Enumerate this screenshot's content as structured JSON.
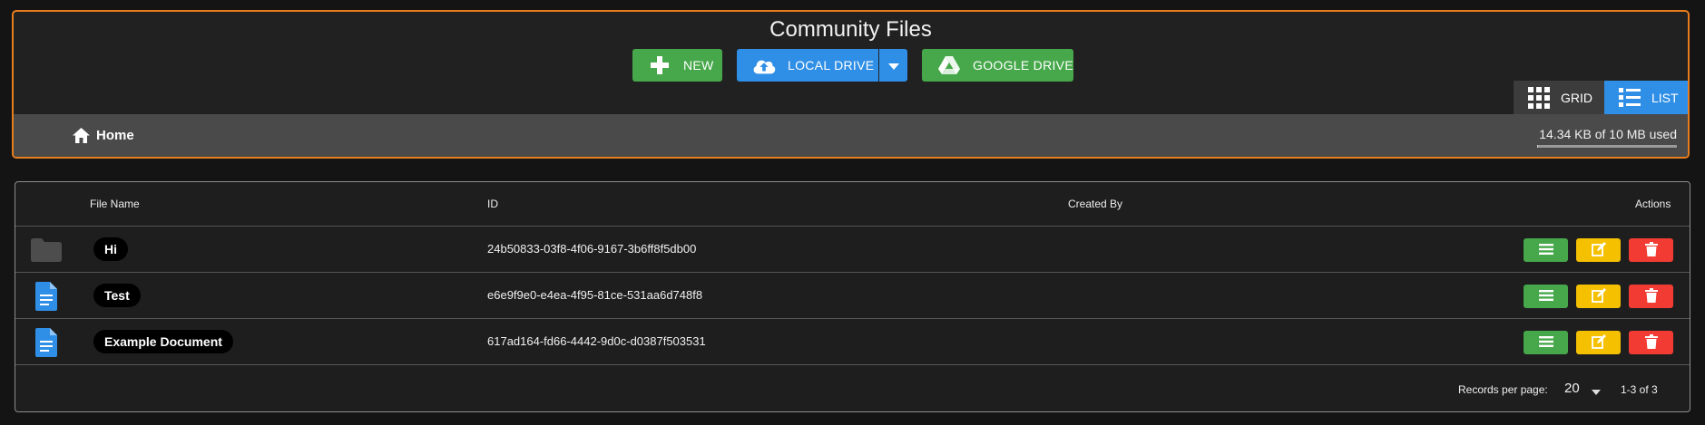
{
  "header": {
    "title": "Community Files",
    "buttons": {
      "new_label": "NEW",
      "local_drive_label": "LOCAL DRIVE",
      "google_drive_label": "GOOGLE DRIVE"
    },
    "view_toggle": {
      "grid_label": "GRID",
      "list_label": "LIST",
      "active": "LIST"
    },
    "breadcrumb": {
      "home_label": "Home"
    },
    "storage": {
      "usage_text": "14.34 KB of 10 MB used",
      "used_fraction": 0.0014
    }
  },
  "table": {
    "columns": {
      "file_name": "File Name",
      "id": "ID",
      "created_by": "Created By",
      "actions": "Actions"
    },
    "rows": [
      {
        "type": "folder-icon",
        "name": "Hi",
        "id": "24b50833-03f8-4f06-9167-3b6ff8f5db00",
        "created_by": ""
      },
      {
        "type": "document-icon",
        "name": "Test",
        "id": "e6e9f9e0-e4ea-4f95-81ce-531aa6d748f8",
        "created_by": ""
      },
      {
        "type": "document-icon",
        "name": "Example Document",
        "id": "617ad164-fd66-4442-9d0c-d0387f503531",
        "created_by": ""
      }
    ],
    "footer": {
      "records_per_page_label": "Records per page:",
      "records_per_page_value": "20",
      "range_text": "1-3 of 3"
    }
  },
  "colors": {
    "accent_orange": "#e87d1e",
    "green": "#46a84a",
    "blue": "#2f8fe6",
    "yellow": "#f5c000",
    "red": "#f23c33"
  }
}
